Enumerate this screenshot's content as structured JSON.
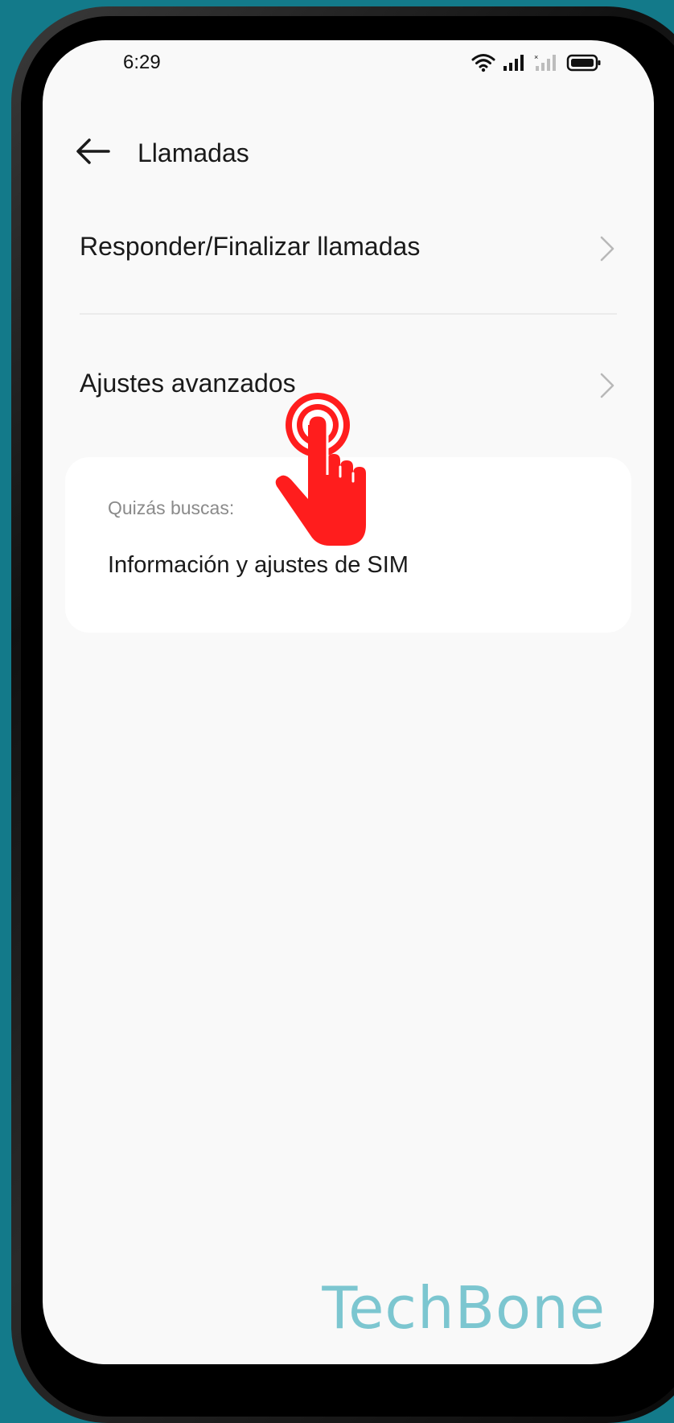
{
  "status_bar": {
    "time": "6:29",
    "icons": [
      "wifi-icon",
      "signal-icon",
      "signal-no-sim-icon",
      "battery-icon"
    ]
  },
  "header": {
    "back_icon": "arrow-left-icon",
    "title": "Llamadas"
  },
  "menu": {
    "items": [
      {
        "label": "Responder/Finalizar llamadas",
        "icon": "chevron-right-icon"
      },
      {
        "label": "Ajustes avanzados",
        "icon": "chevron-right-icon"
      }
    ]
  },
  "suggestions": {
    "heading": "Quizás buscas:",
    "items": [
      {
        "label": "Información y ajustes de SIM"
      }
    ]
  },
  "overlay": {
    "tap_indicator_icon": "tap-hand-icon",
    "accent_color": "#ff1d1d"
  },
  "watermark": {
    "text": "TechBone"
  }
}
